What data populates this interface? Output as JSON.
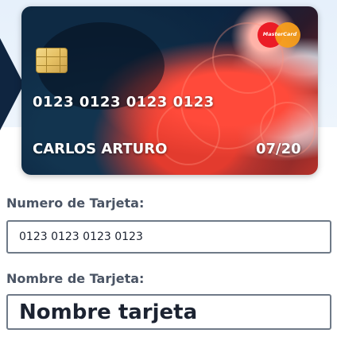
{
  "card": {
    "number": "0123 0123 0123 0123",
    "holder": "CARLOS ARTURO",
    "expiry": "07/20",
    "brand": "MasterCard"
  },
  "form": {
    "number_label": "Numero de Tarjeta:",
    "number_value": "0123 0123 0123 0123",
    "name_label": "Nombre de Tarjeta:",
    "name_placeholder": "Nombre tarjeta"
  },
  "colors": {
    "label_text": "#4a5464",
    "input_border": "#6f7a88",
    "brand_red": "#eb1c26",
    "brand_orange": "#f79e1b"
  }
}
